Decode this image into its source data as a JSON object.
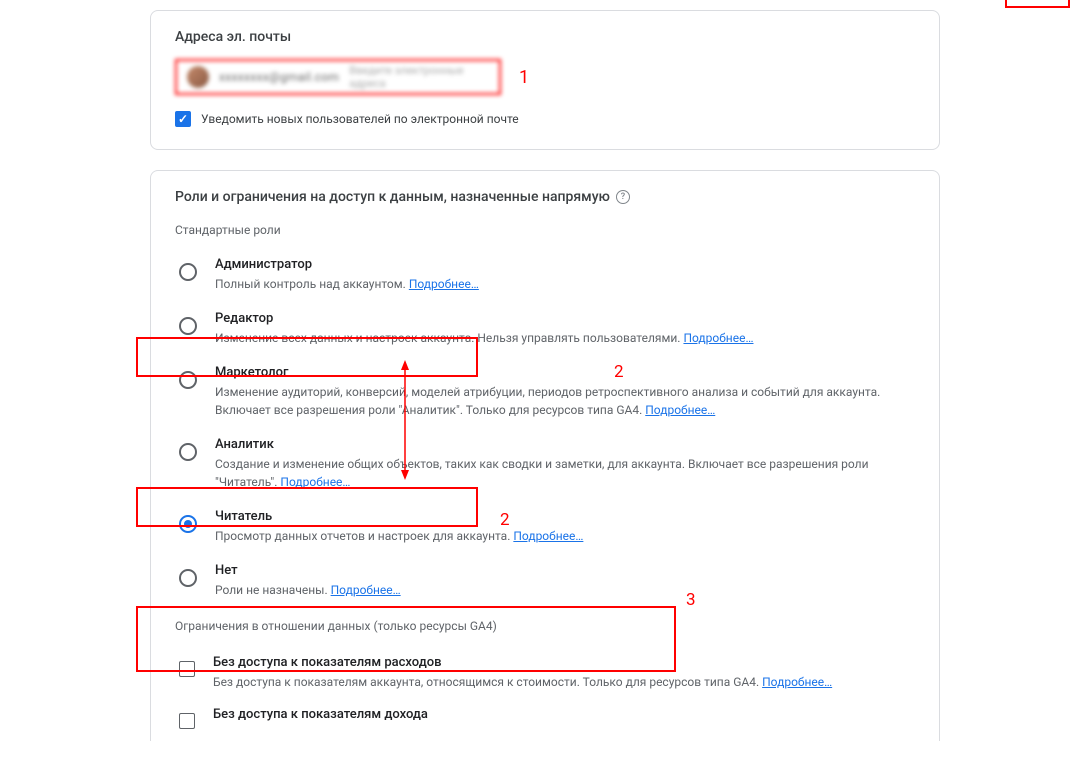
{
  "emailSection": {
    "title": "Адреса эл. почты",
    "chipEmail": "xxxxxxxx@gmail.com",
    "placeholder": "Введите электронные адреса",
    "notifyLabel": "Уведомить новых пользователей по электронной почте",
    "notifyChecked": true
  },
  "rolesSection": {
    "title": "Роли и ограничения на доступ к данным, назначенные напрямую",
    "standardRolesLabel": "Стандартные роли",
    "learnMore": "Подробнее…",
    "roles": [
      {
        "name": "Администратор",
        "desc": "Полный контроль над аккаунтом.",
        "selected": false
      },
      {
        "name": "Редактор",
        "desc": "Изменение всех данных и настроек аккаунта. Нельзя управлять пользователями.",
        "selected": false
      },
      {
        "name": "Маркетолог",
        "desc": "Изменение аудиторий, конверсий, моделей атрибуции, периодов ретроспективного анализа и событий для аккаунта. Включает все разрешения роли \"Аналитик\". Только для ресурсов типа GA4.",
        "selected": false
      },
      {
        "name": "Аналитик",
        "desc": "Создание и изменение общих объектов, таких как сводки и заметки, для аккаунта. Включает все разрешения роли \"Читатель\".",
        "selected": false
      },
      {
        "name": "Читатель",
        "desc": "Просмотр данных отчетов и настроек для аккаунта.",
        "selected": true
      },
      {
        "name": "Нет",
        "desc": "Роли не назначены.",
        "selected": false
      }
    ],
    "restrictionsLabel": "Ограничения в отношении данных (только ресурсы GA4)",
    "restrictions": [
      {
        "name": "Без доступа к показателям расходов",
        "desc": "Без доступа к показателям аккаунта, относящимся к стоимости. Только для ресурсов типа GA4."
      },
      {
        "name": "Без доступа к показателям дохода",
        "desc": ""
      }
    ]
  },
  "annotations": {
    "a1": "1",
    "a2": "2",
    "a3": "3"
  }
}
